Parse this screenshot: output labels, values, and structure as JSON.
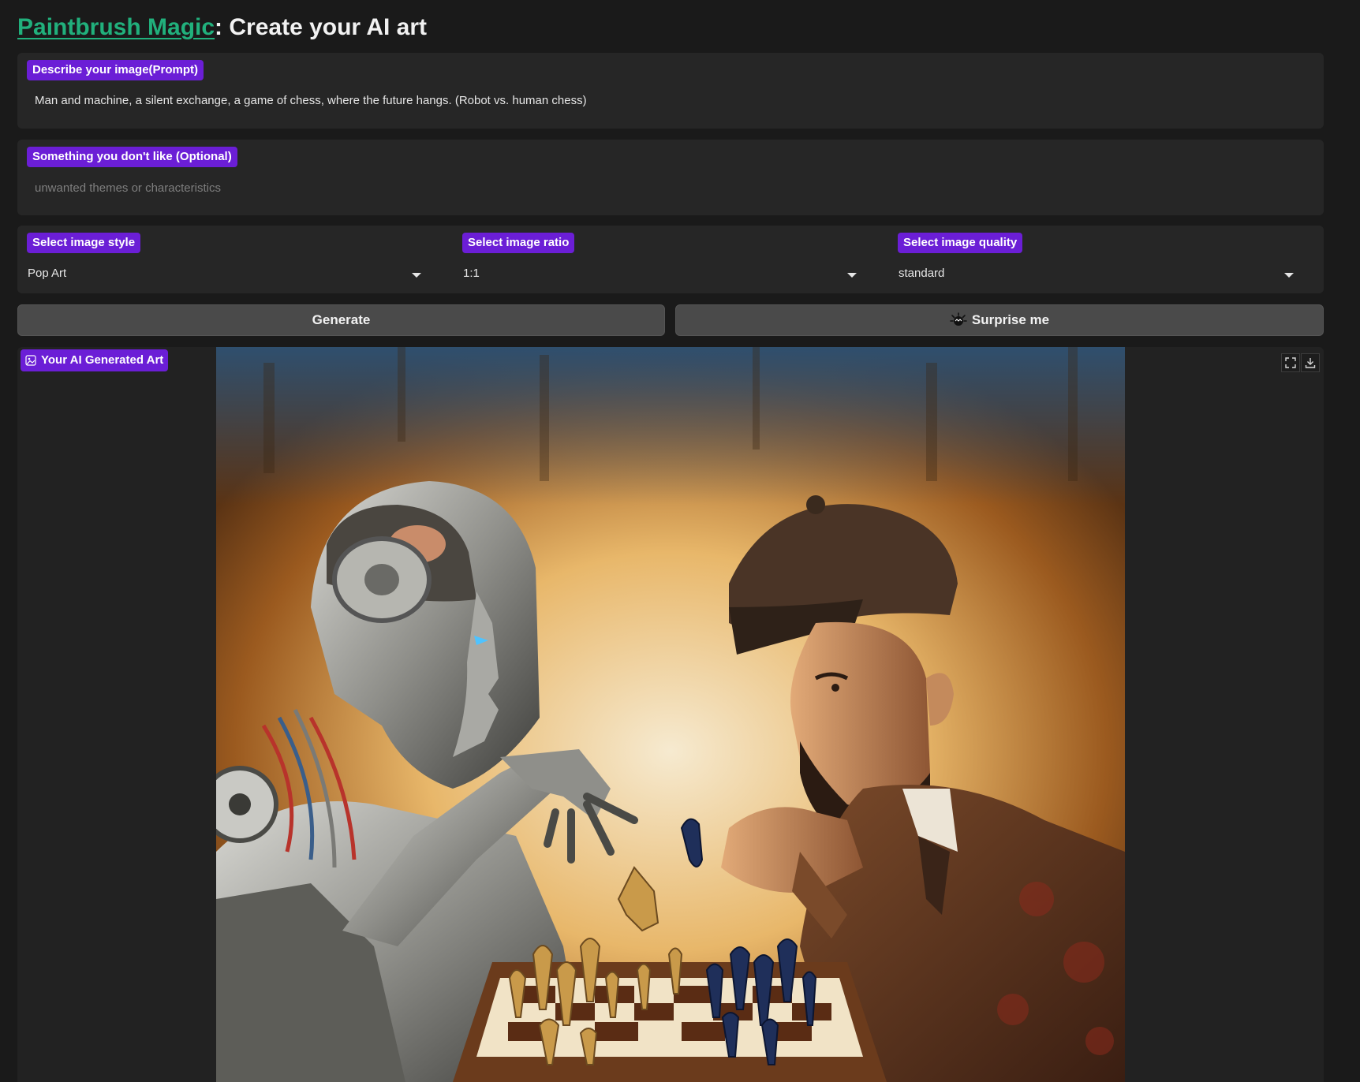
{
  "header": {
    "brand": "Paintbrush Magic",
    "title_rest": ": Create your AI art"
  },
  "prompt": {
    "label": "Describe your image(Prompt)",
    "value": "Man and machine, a silent exchange, a game of chess, where the future hangs. (Robot vs. human chess)"
  },
  "negative": {
    "label": "Something you don't like (Optional)",
    "placeholder": "unwanted themes or characteristics"
  },
  "options": {
    "style": {
      "label": "Select image style",
      "value": "Pop Art"
    },
    "ratio": {
      "label": "Select image ratio",
      "value": "1:1"
    },
    "quality": {
      "label": "Select image quality",
      "value": "standard"
    }
  },
  "actions": {
    "generate_label": "Generate",
    "surprise_label": "Surprise me"
  },
  "output": {
    "label": "Your AI Generated Art"
  },
  "colors": {
    "accent": "#6b1ed6",
    "brand_link": "#21b07c",
    "background": "#1a1a1a",
    "panel": "#262626",
    "button": "#4a4a4a"
  }
}
